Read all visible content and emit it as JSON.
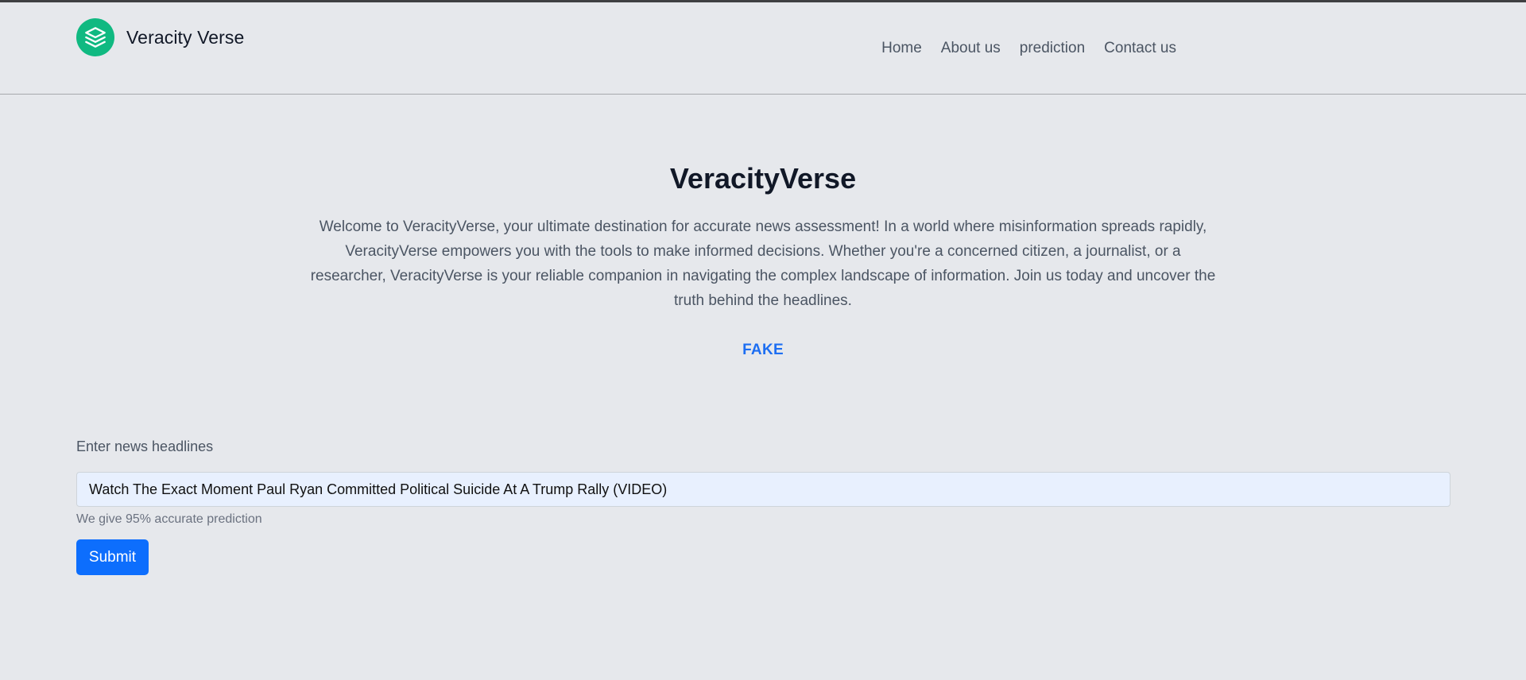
{
  "colors": {
    "page_background": "#e6e8ec",
    "brand_logo": "#10b981",
    "result_text": "#1d6ef2",
    "primary_button": "#0d6efd",
    "input_background": "#e8f0fe"
  },
  "header": {
    "brand_icon": "layers-icon",
    "brand_name": "Veracity Verse",
    "nav": [
      {
        "label": "Home"
      },
      {
        "label": "About us"
      },
      {
        "label": "prediction"
      },
      {
        "label": "Contact us"
      }
    ]
  },
  "hero": {
    "title": "VeracityVerse",
    "description": "Welcome to VeracityVerse, your ultimate destination for accurate news assessment! In a world where misinformation spreads rapidly, VeracityVerse empowers you with the tools to make informed decisions. Whether you're a concerned citizen, a journalist, or a researcher, VeracityVerse is your reliable companion in navigating the complex landscape of information. Join us today and uncover the truth behind the headlines.",
    "result": "FAKE"
  },
  "form": {
    "label": "Enter news headlines",
    "input_value": "Watch The Exact Moment Paul Ryan Committed Political Suicide At A Trump Rally (VIDEO)",
    "help_text": "We give 95% accurate prediction",
    "submit_label": "Submit"
  }
}
